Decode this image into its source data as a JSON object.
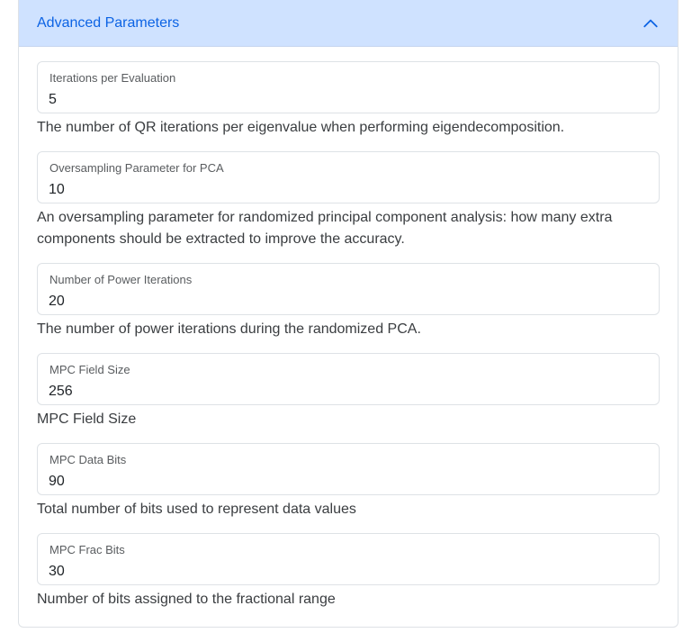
{
  "accordion": {
    "title": "Advanced Parameters",
    "toggle_icon": "chevron-up-icon",
    "colors": {
      "header_bg": "#cfe2ff",
      "header_text": "#0c63e4"
    }
  },
  "fields": [
    {
      "label": "Iterations per Evaluation",
      "value": "5",
      "help": "The number of QR iterations per eigenvalue when performing eigendecomposition."
    },
    {
      "label": "Oversampling Parameter for PCA",
      "value": "10",
      "help": "An oversampling parameter for randomized principal component analysis: how many extra components should be extracted to improve the accuracy."
    },
    {
      "label": "Number of Power Iterations",
      "value": "20",
      "help": "The number of power iterations during the randomized PCA."
    },
    {
      "label": "MPC Field Size",
      "value": "256",
      "help": "MPC Field Size"
    },
    {
      "label": "MPC Data Bits",
      "value": "90",
      "help": "Total number of bits used to represent data values"
    },
    {
      "label": "MPC Frac Bits",
      "value": "30",
      "help": "Number of bits assigned to the fractional range"
    }
  ]
}
